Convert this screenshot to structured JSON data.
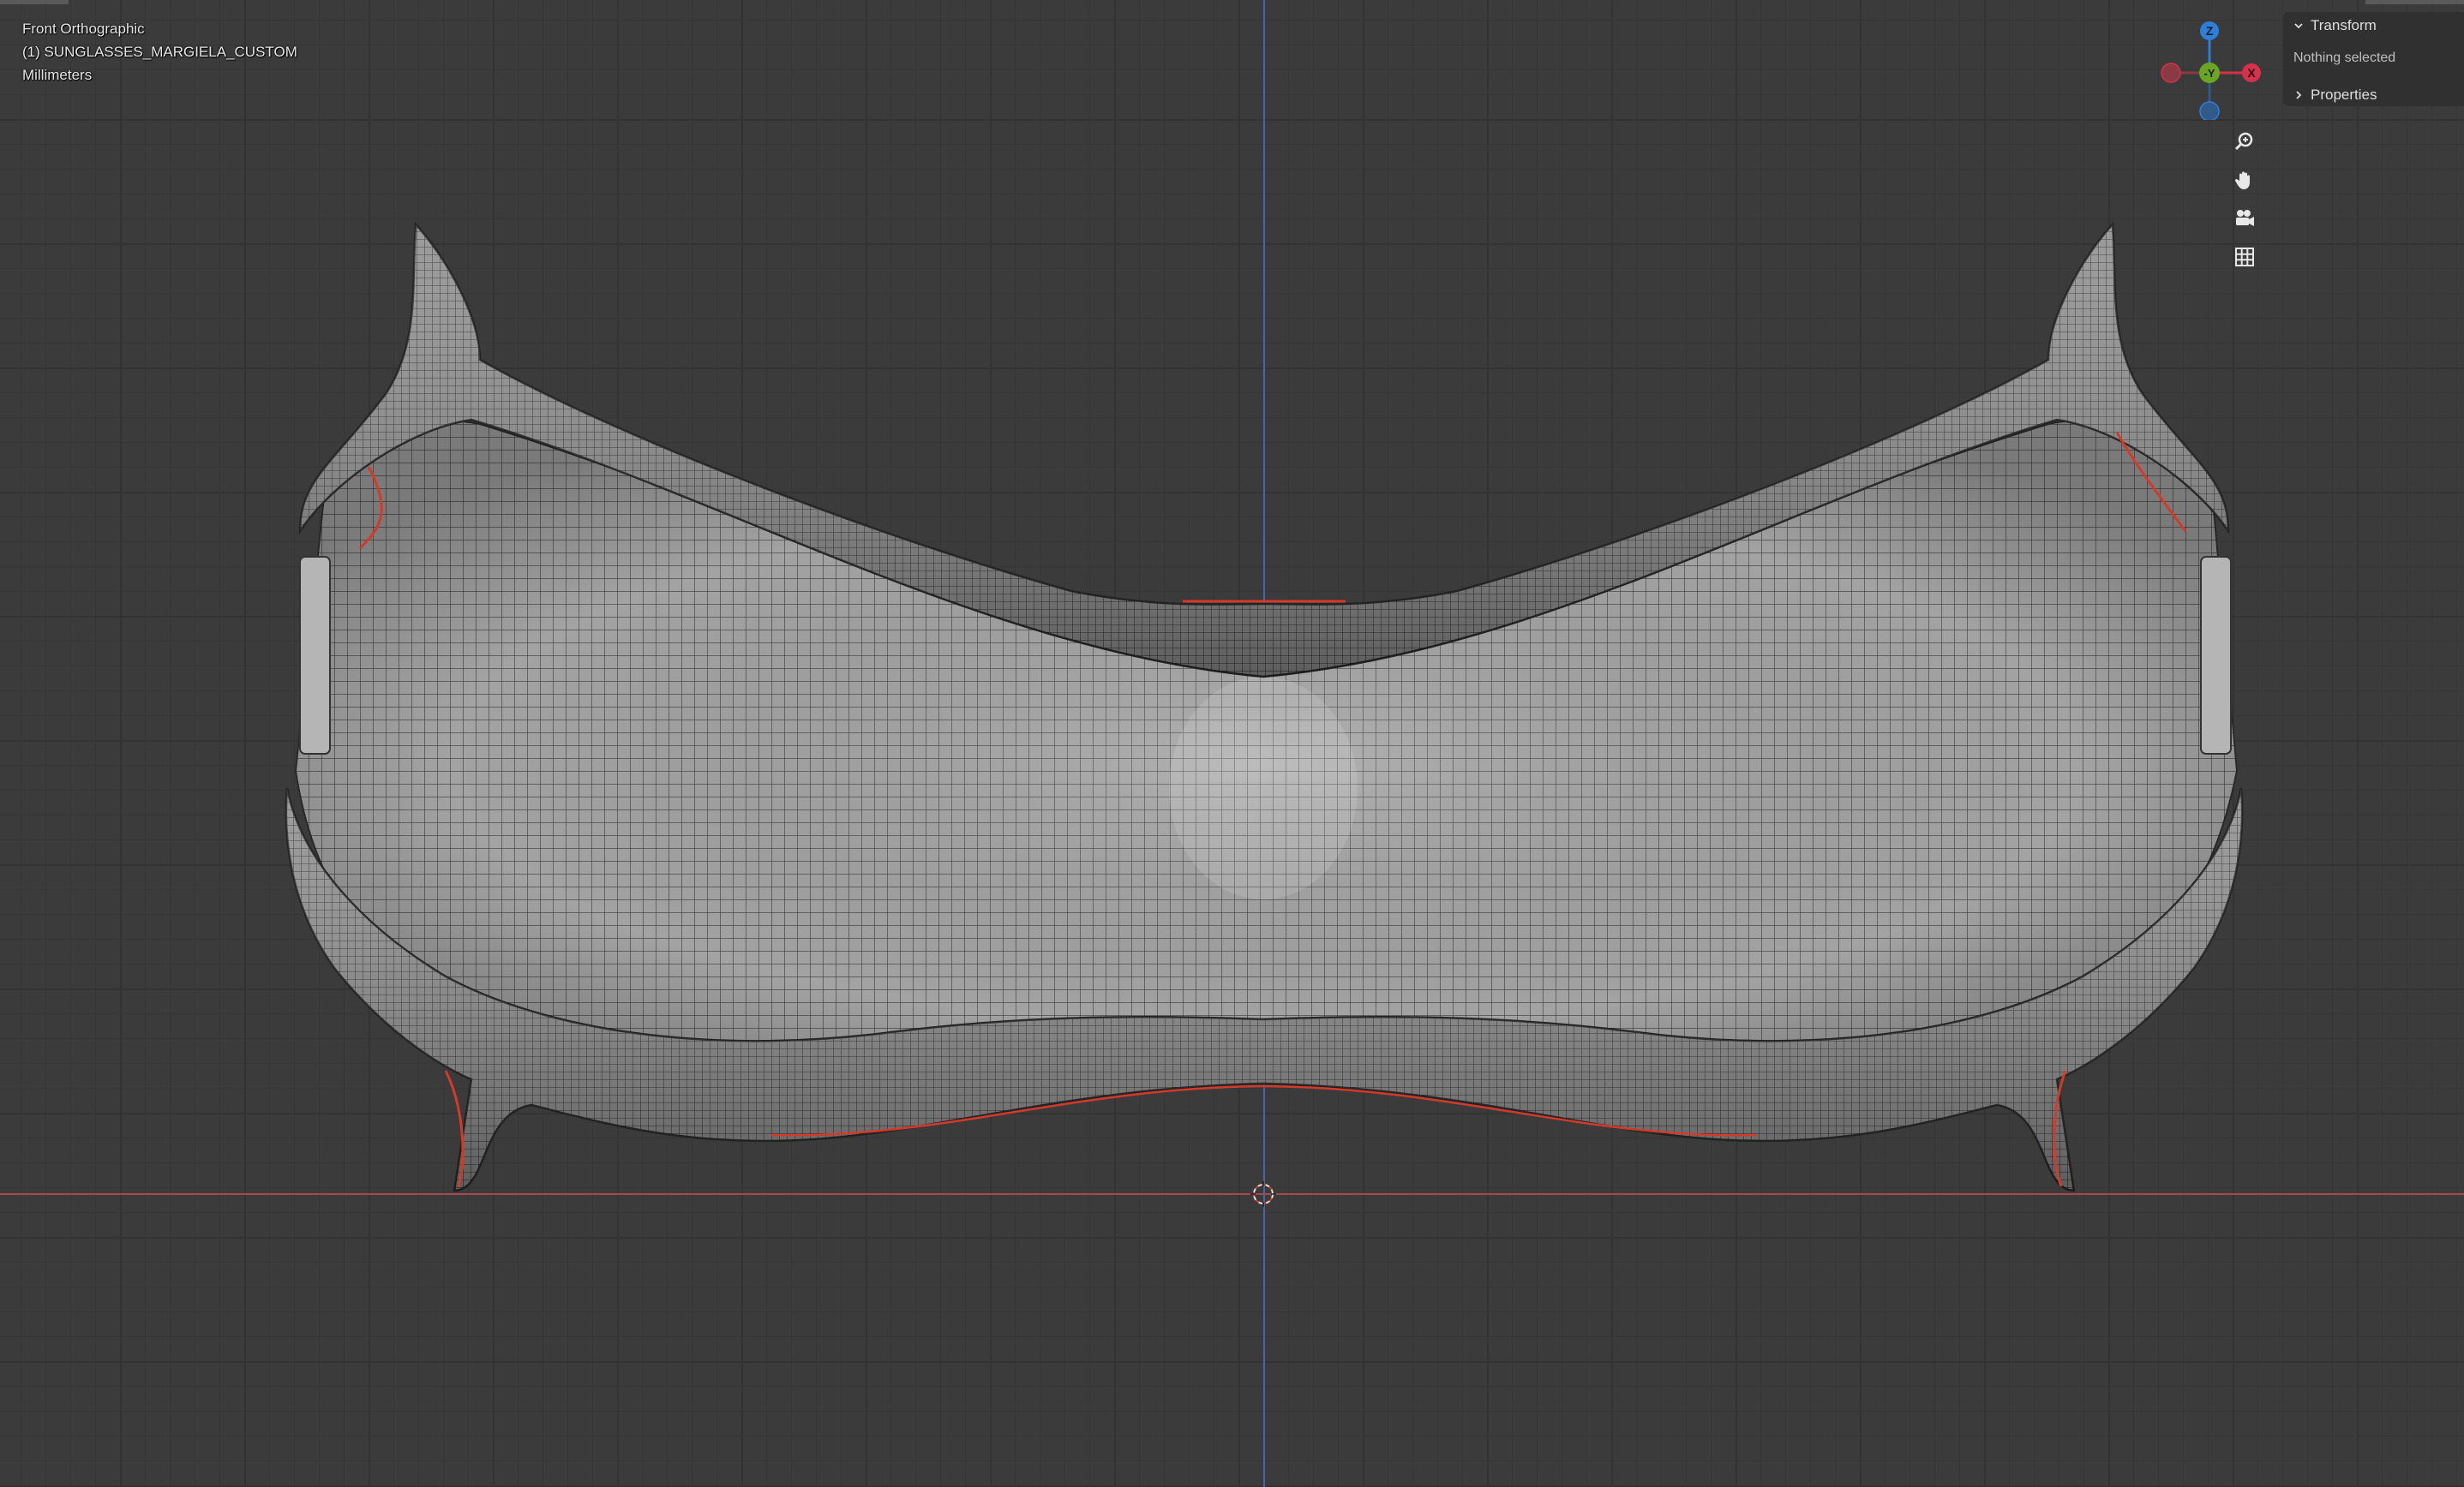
{
  "viewport": {
    "view_name": "Front Orthographic",
    "object_info": "(1) SUNGLASSES_MARGIELA_CUSTOM",
    "units": "Millimeters"
  },
  "gizmo": {
    "axes": [
      {
        "label": "Z",
        "color": "#2f7fd8"
      },
      {
        "label": "Y",
        "color": "#6aa523"
      },
      {
        "label": "X",
        "color": "#d6304b"
      }
    ],
    "tools": [
      "zoom-icon",
      "hand-pan-icon",
      "camera-icon",
      "grid-icon"
    ]
  },
  "sidebar": {
    "transform_label": "Transform",
    "selection_status": "Nothing selected",
    "properties_label": "Properties"
  },
  "colors": {
    "background": "#3b3b3b",
    "grid_minor": "#353535",
    "z_axis_line": "#4d63a8",
    "x_axis_line": "#a84848",
    "mesh_fill": "#9a9a9a",
    "wire": "#2e2e2e",
    "edge_highlight": "#d23a2a"
  }
}
